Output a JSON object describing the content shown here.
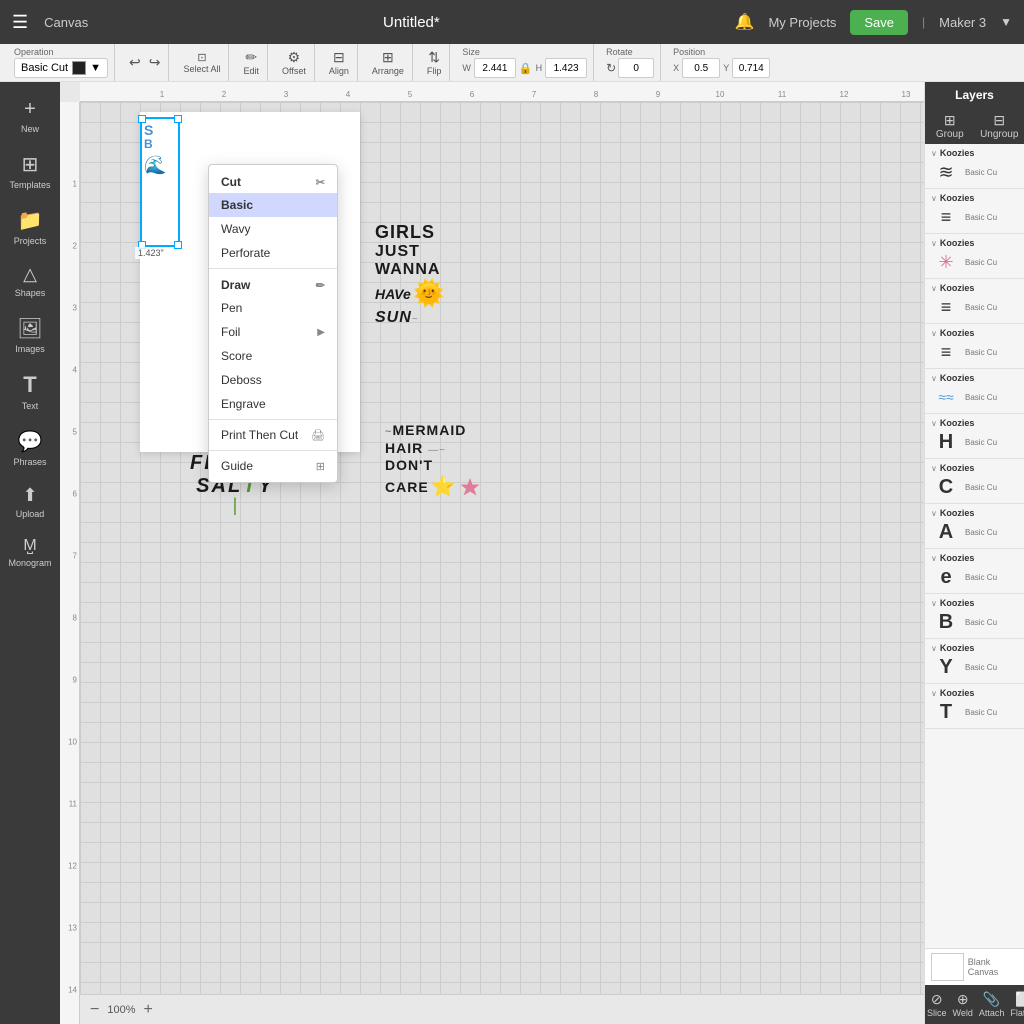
{
  "topbar": {
    "menu_icon": "☰",
    "canvas_label": "Canvas",
    "title": "Untitled*",
    "bell_icon": "🔔",
    "my_projects": "My Projects",
    "save_label": "Save",
    "divider": "|",
    "maker_label": "Maker 3",
    "maker_chevron": "▼"
  },
  "toolbar": {
    "operation_label": "Operation",
    "operation_value": "Basic Cut",
    "select_all": "Select All",
    "edit_label": "Edit",
    "offset_label": "Offset",
    "align_label": "Align",
    "arrange_label": "Arrange",
    "flip_label": "Flip",
    "size_label": "Size",
    "w_label": "W",
    "w_value": "2.441",
    "lock_icon": "🔒",
    "h_label": "H",
    "h_value": "1.423",
    "rotate_label": "Rotate",
    "rotate_value": "0",
    "position_label": "Position",
    "x_label": "X",
    "x_value": "0.5",
    "y_label": "Y",
    "y_value": "0.714"
  },
  "sidebar": {
    "items": [
      {
        "label": "New",
        "icon": "+"
      },
      {
        "label": "Templates",
        "icon": "⊞"
      },
      {
        "label": "Projects",
        "icon": "📁"
      },
      {
        "label": "Shapes",
        "icon": "△"
      },
      {
        "label": "Images",
        "icon": "🖼"
      },
      {
        "label": "Text",
        "icon": "T"
      },
      {
        "label": "Phrases",
        "icon": "💬"
      },
      {
        "label": "Upload",
        "icon": "↑"
      },
      {
        "label": "Monogram",
        "icon": "M"
      }
    ]
  },
  "canvas": {
    "zoom": "100%",
    "dimension_label": "1.423\""
  },
  "operation_menu": {
    "cut_label": "Cut",
    "cut_kbd": "⌘",
    "basic_label": "Basic",
    "wavy_label": "Wavy",
    "perforate_label": "Perforate",
    "draw_label": "Draw",
    "draw_icon": "✏",
    "pen_label": "Pen",
    "foil_label": "Foil",
    "foil_arrow": "▶",
    "score_label": "Score",
    "deboss_label": "Deboss",
    "engrave_label": "Engrave",
    "print_then_cut_label": "Print Then Cut",
    "guide_label": "Guide",
    "guide_kbd": "⊞"
  },
  "right_panel": {
    "layers_title": "Layers",
    "group_label": "Group",
    "ungroup_label": "Ungroup",
    "layers": [
      {
        "title": "Koozies",
        "thumb": "≋",
        "info": "Basic Cu",
        "thumb_color": "#333"
      },
      {
        "title": "Koozies",
        "thumb": "≡",
        "info": "Basic Cu",
        "thumb_color": "#333"
      },
      {
        "title": "Koozies",
        "thumb": "✳",
        "info": "Basic Cu",
        "thumb_color": "#e07090"
      },
      {
        "title": "Koozies",
        "thumb": "≡",
        "info": "Basic Cu",
        "thumb_color": "#333"
      },
      {
        "title": "Koozies",
        "thumb": "≡",
        "info": "Basic Cu",
        "thumb_color": "#333"
      },
      {
        "title": "Koozies",
        "thumb": "≈≈",
        "info": "Basic Cu",
        "thumb_color": "#4a9adc"
      },
      {
        "title": "Koozies",
        "thumb": "H",
        "info": "Basic Cu",
        "thumb_color": "#333"
      },
      {
        "title": "Koozies",
        "thumb": "C",
        "info": "Basic Cu",
        "thumb_color": "#333"
      },
      {
        "title": "Koozies",
        "thumb": "A",
        "info": "Basic Cu",
        "thumb_color": "#333"
      },
      {
        "title": "Koozies",
        "thumb": "e",
        "info": "Basic Cu",
        "thumb_color": "#333"
      },
      {
        "title": "Koozies",
        "thumb": "B",
        "info": "Basic Cu",
        "thumb_color": "#333"
      },
      {
        "title": "Koozies",
        "thumb": "Y",
        "info": "Basic Cu",
        "thumb_color": "#333"
      },
      {
        "title": "Koozies",
        "thumb": "T",
        "info": "Basic Cu",
        "thumb_color": "#333"
      }
    ],
    "bottom_actions": {
      "weld": "Weld",
      "attach": "Attach",
      "flatten": "Flatten",
      "slice": "Slice"
    }
  },
  "canvas_designs": {
    "girls_text": "GIRLS\nJUST\nWANNA\nHAVe\nSUN",
    "mermaid_text": "MERMAID\nHAIR\nDON'T\nCARE",
    "feelin_text": "FEELIN'\nSALTY"
  }
}
